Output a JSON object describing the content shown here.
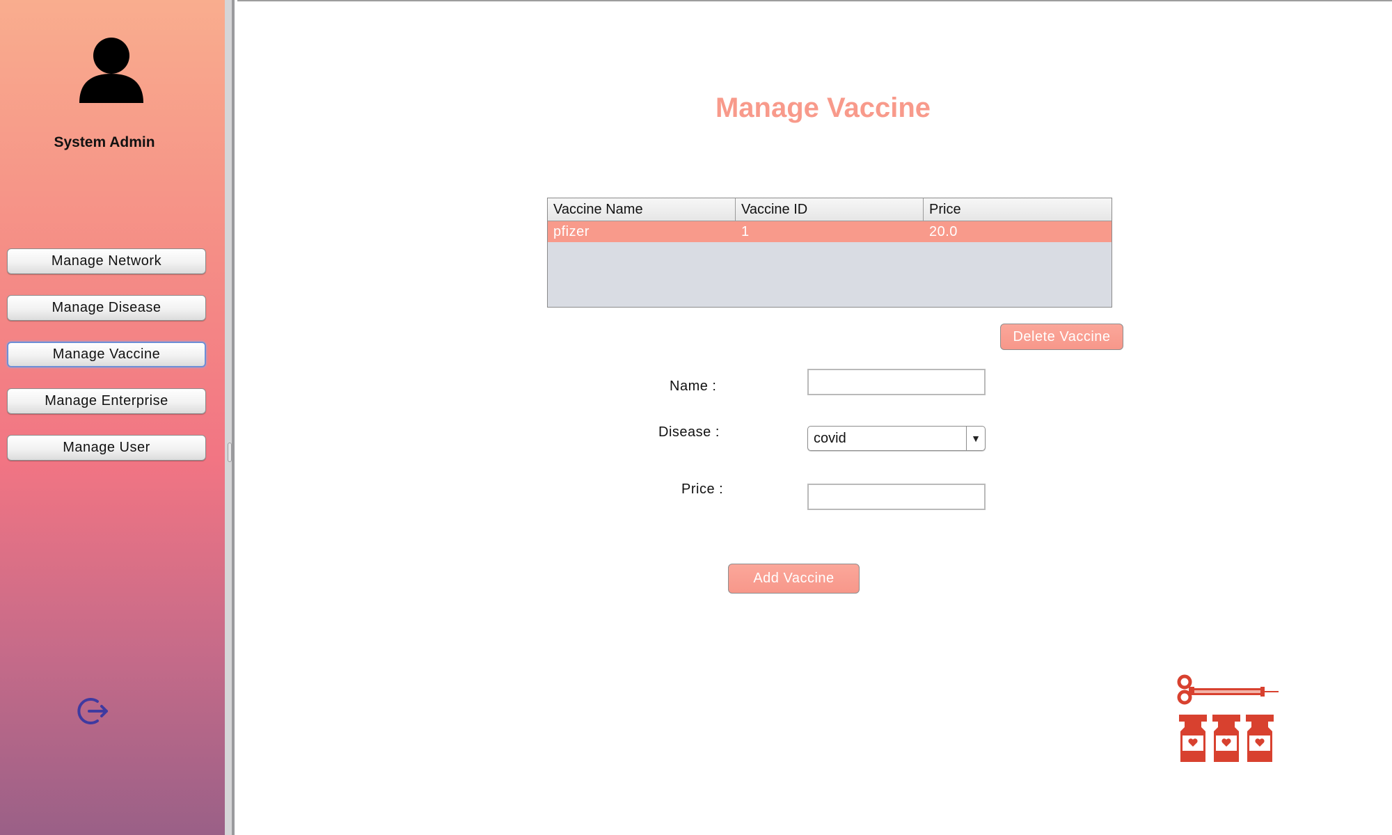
{
  "sidebar": {
    "admin_label": "System Admin",
    "items": [
      {
        "label": "Manage Network"
      },
      {
        "label": "Manage Disease"
      },
      {
        "label": "Manage Vaccine",
        "active": true
      },
      {
        "label": "Manage Enterprise"
      },
      {
        "label": "Manage User"
      }
    ],
    "icons": {
      "avatar": "user-avatar-icon",
      "logout": "logout-icon"
    }
  },
  "main": {
    "title": "Manage Vaccine",
    "table": {
      "columns": [
        "Vaccine Name",
        "Vaccine ID",
        "Price"
      ],
      "rows": [
        [
          "pfizer",
          "1",
          "20.0"
        ]
      ],
      "selected_row": 0
    },
    "delete_button": "Delete Vaccine",
    "form": {
      "name_label": "Name :",
      "name_value": "",
      "disease_label": "Disease :",
      "disease_value": "covid",
      "price_label": "Price :",
      "price_value": ""
    },
    "add_button": "Add Vaccine",
    "illustration": "vaccine-syringe-vials-icon"
  },
  "colors": {
    "accent": "#f89a8b",
    "selected_row": "#f89a8b",
    "logout_icon": "#3f3aa0"
  }
}
